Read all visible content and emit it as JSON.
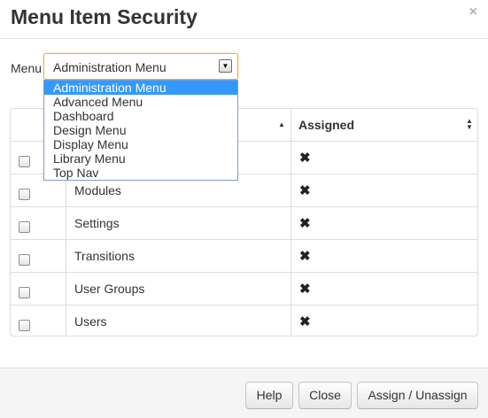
{
  "dialog": {
    "title": "Menu Item Security",
    "close_glyph": "×"
  },
  "menu_select": {
    "label": "Menu",
    "value": "Administration Menu",
    "options": [
      "Administration Menu",
      "Advanced Menu",
      "Dashboard",
      "Design Menu",
      "Display Menu",
      "Library Menu",
      "Top Nav"
    ],
    "selected_index": 0
  },
  "table": {
    "headers": {
      "name": "",
      "assigned": "Assigned"
    },
    "rows": [
      {
        "name": "",
        "assigned": "✖"
      },
      {
        "name": "Modules",
        "assigned": "✖"
      },
      {
        "name": "Settings",
        "assigned": "✖"
      },
      {
        "name": "Transitions",
        "assigned": "✖"
      },
      {
        "name": "User Groups",
        "assigned": "✖"
      },
      {
        "name": "Users",
        "assigned": "✖"
      }
    ]
  },
  "footer": {
    "help_label": "Help",
    "close_label": "Close",
    "assign_label": "Assign / Unassign"
  },
  "icons": {
    "sort_asc": "sort-ascending-icon",
    "sort_both": "sort-both-icon",
    "assigned_x": "cross-icon"
  },
  "colors": {
    "select_focus_border": "#e8b144",
    "option_highlight": "#3399ff",
    "footer_bg": "#f5f5f5"
  }
}
